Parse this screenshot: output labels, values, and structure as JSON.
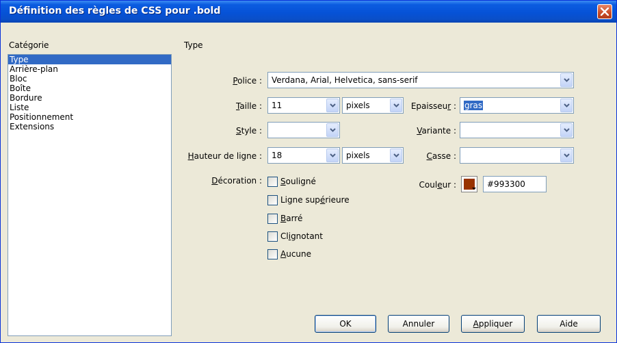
{
  "window": {
    "title": "Définition des règles de CSS pour .bold"
  },
  "sidebar": {
    "header": "Catégorie",
    "items": [
      "Type",
      "Arrière-plan",
      "Bloc",
      "Boîte",
      "Bordure",
      "Liste",
      "Positionnement",
      "Extensions"
    ],
    "selected": "Type"
  },
  "panel": {
    "title": "Type"
  },
  "form": {
    "police": {
      "label_pre": "",
      "label_key": "P",
      "label_post": "olice :",
      "value": "Verdana, Arial, Helvetica, sans-serif"
    },
    "taille": {
      "label_pre": "",
      "label_key": "T",
      "label_post": "aille :",
      "value": "11",
      "unit": "pixels"
    },
    "epaisseur": {
      "label_pre": "Epaisseu",
      "label_key": "r",
      "label_post": " :",
      "value": "gras"
    },
    "style": {
      "label_pre": "",
      "label_key": "S",
      "label_post": "tyle :",
      "value": ""
    },
    "variante": {
      "label_pre": "",
      "label_key": "V",
      "label_post": "ariante :",
      "value": ""
    },
    "hauteur": {
      "label_pre": "",
      "label_key": "H",
      "label_post": "auteur de ligne :",
      "value": "18",
      "unit": "pixels"
    },
    "casse": {
      "label_pre": "",
      "label_key": "C",
      "label_post": "asse :",
      "value": ""
    },
    "decoration": {
      "label_pre": "",
      "label_key": "D",
      "label_post": "écoration :",
      "options": [
        {
          "pre": "",
          "key": "S",
          "post": "ouligné",
          "checked": false
        },
        {
          "pre": "Ligne sup",
          "key": "é",
          "post": "rieure",
          "checked": false
        },
        {
          "pre": "",
          "key": "B",
          "post": "arré",
          "checked": false
        },
        {
          "pre": "Cl",
          "key": "i",
          "post": "gnotant",
          "checked": false
        },
        {
          "pre": "",
          "key": "A",
          "post": "ucune",
          "checked": false
        }
      ]
    },
    "couleur": {
      "label_pre": "Coul",
      "label_key": "e",
      "label_post": "ur :",
      "value": "#993300",
      "swatch": "#993300"
    }
  },
  "buttons": {
    "ok": "OK",
    "annuler": "Annuler",
    "appliquer": {
      "pre": "",
      "key": "A",
      "post": "ppliquer"
    },
    "aide": "Aide"
  },
  "icons": {
    "close": "close-icon",
    "dropdown": "chevron-down-icon"
  }
}
